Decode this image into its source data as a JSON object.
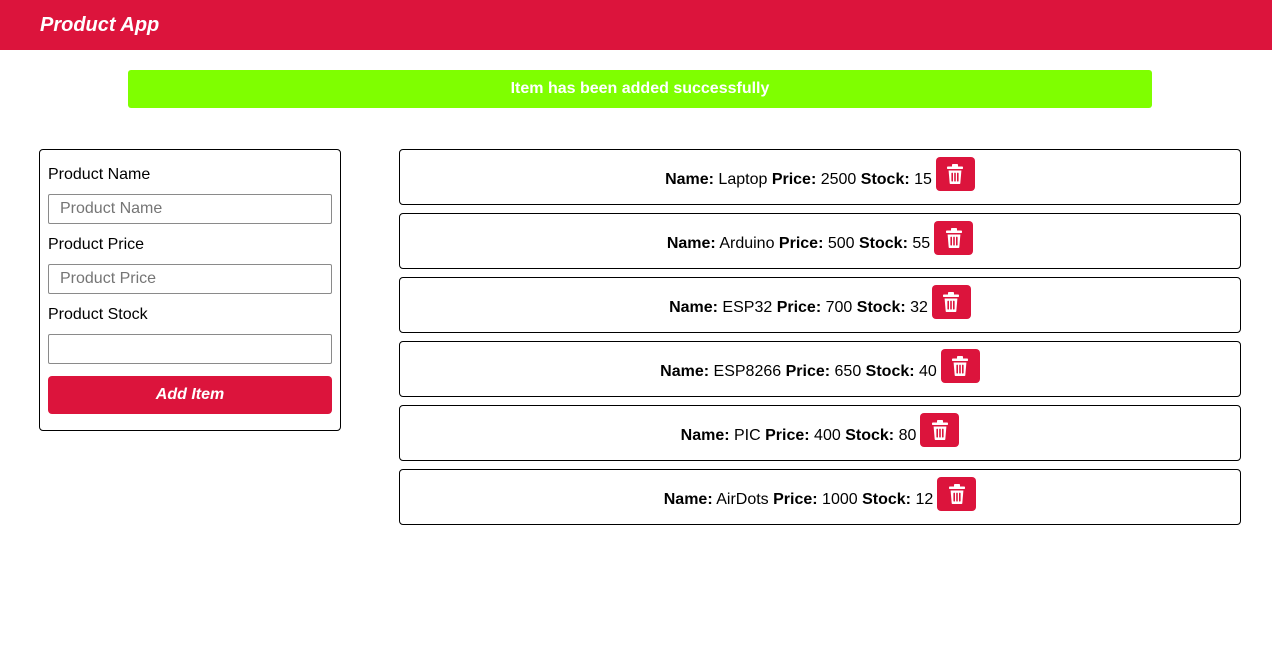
{
  "navbar": {
    "title": "Product App"
  },
  "alert": {
    "message": "Item has been added successfully",
    "color": "#7fff00"
  },
  "form": {
    "name_label": "Product Name",
    "name_placeholder": "Product Name",
    "name_value": "",
    "price_label": "Product Price",
    "price_placeholder": "Product Price",
    "price_value": "",
    "stock_label": "Product Stock",
    "stock_placeholder": "",
    "stock_value": "",
    "submit_label": "Add Item"
  },
  "field_labels": {
    "name": "Name:",
    "price": "Price:",
    "stock": "Stock:"
  },
  "products": [
    {
      "name": "Laptop",
      "price": "2500",
      "stock": "15",
      "delete_icon": "trash-icon"
    },
    {
      "name": "Arduino",
      "price": "500",
      "stock": "55",
      "delete_icon": "trash-icon"
    },
    {
      "name": "ESP32",
      "price": "700",
      "stock": "32",
      "delete_icon": "trash-icon"
    },
    {
      "name": "ESP8266",
      "price": "650",
      "stock": "40",
      "delete_icon": "trash-icon"
    },
    {
      "name": "PIC",
      "price": "400",
      "stock": "80",
      "delete_icon": "trash-icon"
    },
    {
      "name": "AirDots",
      "price": "1000",
      "stock": "12",
      "delete_icon": "trash-icon"
    }
  ],
  "colors": {
    "brand": "#dc143c",
    "success": "#7fff00"
  }
}
